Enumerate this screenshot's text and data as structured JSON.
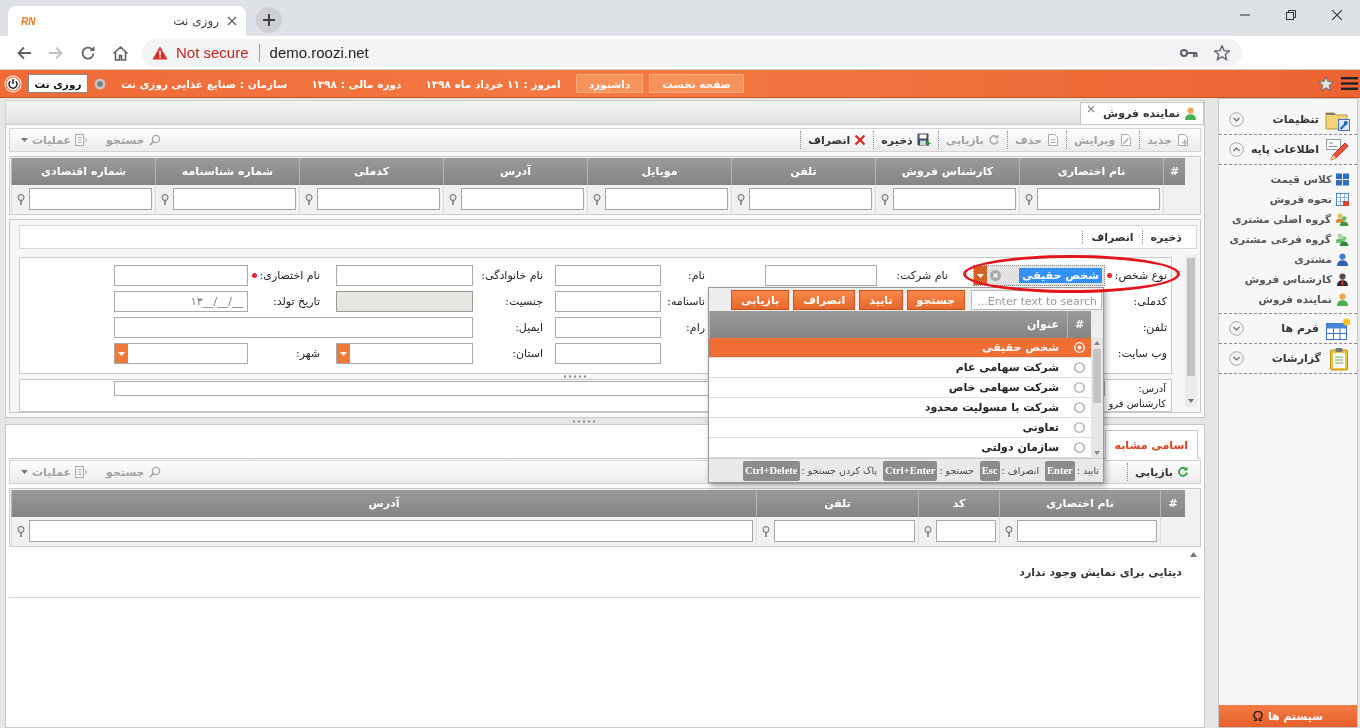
{
  "browser": {
    "tab": {
      "favicon": "RN",
      "title": "روزی نت"
    },
    "security": "Not secure",
    "url": "demo.roozi.net"
  },
  "header": {
    "nav_buttons": [
      "صفحه نخست",
      "داشبورد"
    ],
    "info": [
      "امروز : ۱۱ خرداد ماه ۱۳۹۸",
      "دوره مالی : ۱۳۹۸",
      "سازمان : صنایع غذایی روزی نت"
    ],
    "company": "روزی نت"
  },
  "page_tabs": [
    {
      "title": "نماینده فروش",
      "selected": true
    }
  ],
  "toolbar": {
    "actions": [
      {
        "label": "جدید",
        "kind": "new",
        "disabled": true
      },
      {
        "label": "ویرایش",
        "kind": "edit",
        "disabled": true
      },
      {
        "label": "حذف",
        "kind": "delete",
        "disabled": true
      },
      {
        "label": "بازیابی",
        "kind": "refresh",
        "disabled": true
      },
      {
        "label": "ذخیره",
        "kind": "save",
        "disabled": false
      },
      {
        "label": "انصراف",
        "kind": "cancel",
        "disabled": false
      }
    ],
    "tools": [
      {
        "label": "جستجو",
        "kind": "search",
        "disabled": true
      },
      {
        "label": "عملیات",
        "kind": "operations",
        "disabled": true
      }
    ]
  },
  "grid": {
    "columns": [
      "#",
      "نام اختصاری",
      "کارشناس فروش",
      "تلفن",
      "موبایل",
      "آدرس",
      "کدملی",
      "شماره شناسنامه",
      "شماره اقتصادی"
    ]
  },
  "form": {
    "toolbar": [
      "ذخیره",
      "انصراف"
    ],
    "rows": [
      [
        {
          "label": "نوع شخص:",
          "required": true,
          "kind": "select",
          "value": "شخص حقیقی",
          "value_selected": true,
          "expanded": true,
          "highlighted": true,
          "dropdown": {
            "search_placeholder": "Enter text to search...",
            "buttons": [
              "جستجو",
              "تایید",
              "انصراف",
              "بازیابی"
            ],
            "columns": [
              "#",
              "عنوان"
            ],
            "rows": [
              {
                "title": "شخص حقیقی",
                "selected": true
              },
              {
                "title": "شرکت سهامی عام",
                "selected": false
              },
              {
                "title": "شرکت سهامی خاص",
                "selected": false
              },
              {
                "title": "شرکت با مسولیت محدود",
                "selected": false
              },
              {
                "title": "تعاونی",
                "selected": false
              },
              {
                "title": "سازمان دولتی",
                "selected": false
              }
            ],
            "shortcuts": [
              {
                "label": "تایید :",
                "key": "Enter"
              },
              {
                "label": "انصراف :",
                "key": "Esc"
              },
              {
                "label": "جستجو :",
                "key": "Ctrl+Enter"
              },
              {
                "label": "پاک کردن جستجو :",
                "key": "Ctrl+Delete"
              }
            ]
          }
        },
        {
          "label": "نام شرکت:",
          "required": false,
          "kind": "text",
          "disabled": false
        },
        {
          "label": "نام:",
          "required": false,
          "kind": "text",
          "disabled": false
        },
        {
          "label": "نام خانوادگی:",
          "required": false,
          "kind": "text",
          "disabled": false
        },
        {
          "label": "نام اختصاری:",
          "required": true,
          "kind": "text",
          "disabled": false
        }
      ],
      [
        {
          "label": "کدملی:",
          "required": false,
          "kind": "covered"
        },
        {
          "kind": "covered"
        },
        {
          "label": "ناسنامه:",
          "required": false,
          "kind": "text",
          "disabled": false
        },
        {
          "label": "جنسیت:",
          "required": false,
          "kind": "text",
          "disabled": true
        },
        {
          "label": "تاریخ تولد:",
          "required": false,
          "kind": "date",
          "placeholder": "۱۳__/__/__"
        }
      ],
      [
        {
          "label": "تلفن:",
          "required": false,
          "kind": "covered"
        },
        {
          "kind": "covered"
        },
        {
          "label": "رام:",
          "required": false,
          "kind": "text",
          "disabled": false
        },
        {
          "label": "ایمیل:",
          "required": false,
          "kind": "wide"
        }
      ],
      [
        {
          "label": "وب سایت:",
          "required": false,
          "kind": "covered"
        },
        {
          "kind": "covered"
        },
        {
          "kind": "text",
          "disabled": false
        },
        {
          "label": "استان:",
          "required": false,
          "kind": "select",
          "expanded": false,
          "highlighted": false
        },
        {
          "label": "شهر:",
          "required": false,
          "kind": "select",
          "expanded": false,
          "highlighted": false
        }
      ]
    ],
    "address": {
      "label": "آدرس:"
    },
    "cut_label": "کارشناس فرو"
  },
  "similar": {
    "tabs": [
      {
        "label": "اسامی مشابه",
        "selected": true
      }
    ],
    "toolbar": {
      "actions": [
        {
          "label": "بازیابی",
          "kind": "refresh",
          "disabled": false
        }
      ],
      "tools": [
        {
          "label": "جستجو",
          "kind": "search",
          "disabled": true
        },
        {
          "label": "عملیات",
          "kind": "operations",
          "disabled": true
        }
      ]
    },
    "columns": [
      "#",
      "نام اختصاری",
      "کد",
      "تلفن",
      "آدرس"
    ],
    "empty_message": "دیتایی برای نمایش وجود ندارد"
  },
  "sidebar": {
    "sections": [
      {
        "title": "تنظیمات",
        "kind": "settings",
        "expanded": false
      },
      {
        "title": "اطلاعات پایه",
        "kind": "base",
        "expanded": true,
        "items": [
          {
            "label": "کلاس قیمت",
            "kind": "grid"
          },
          {
            "label": "نحوه فروش",
            "kind": "table"
          },
          {
            "label": "گروه اصلی مشتری",
            "kind": "group"
          },
          {
            "label": "گروه فرعی مشتری",
            "kind": "subgroup"
          },
          {
            "label": "مشتری",
            "kind": "customer"
          },
          {
            "label": "کارشناس فروش",
            "kind": "expert"
          },
          {
            "label": "نماینده فروش",
            "kind": "agent"
          }
        ]
      },
      {
        "title": "فرم ها",
        "kind": "forms",
        "expanded": false
      },
      {
        "title": "گزارشات",
        "kind": "reports",
        "expanded": false
      }
    ],
    "footer": "سیستم ها"
  }
}
